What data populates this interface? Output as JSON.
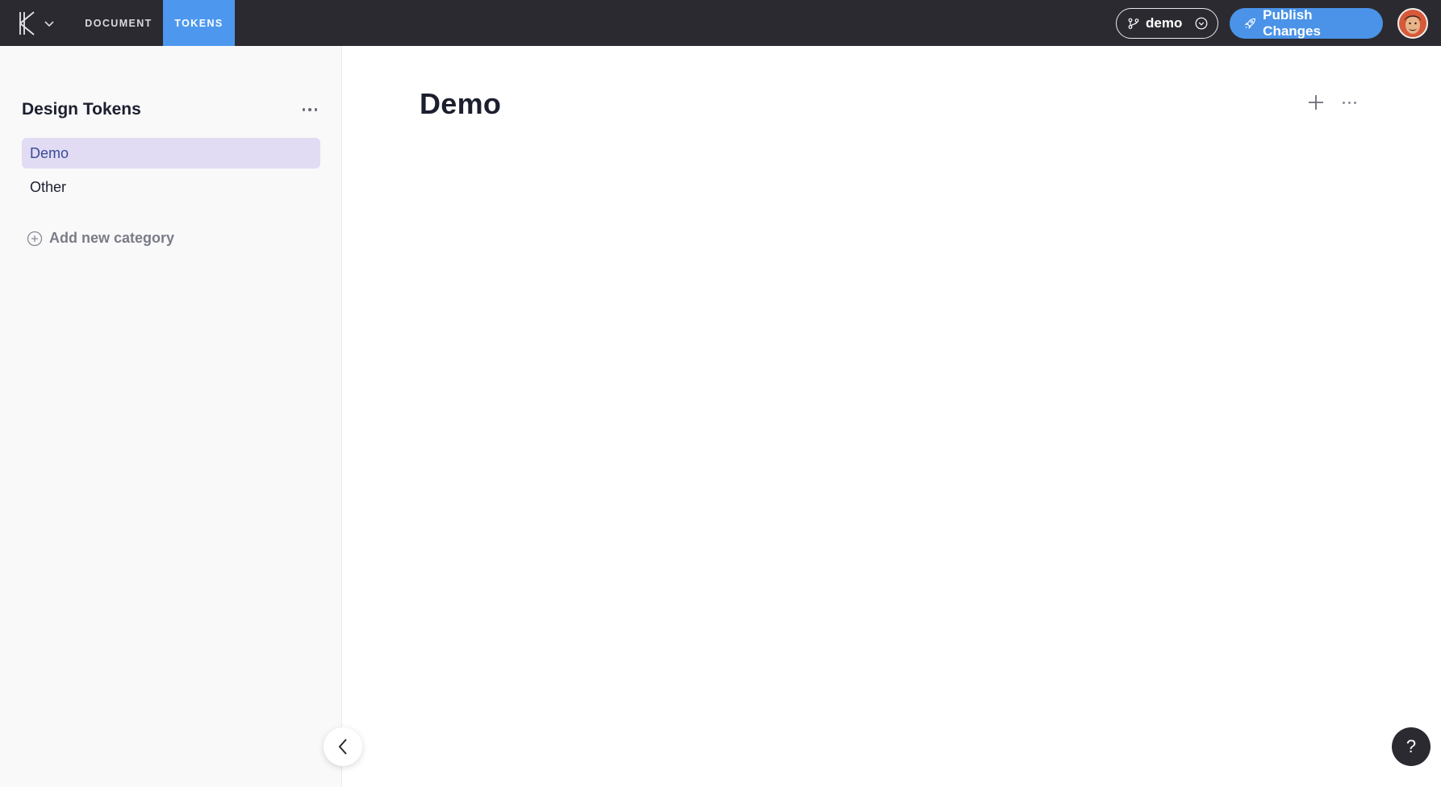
{
  "topbar": {
    "tabs": [
      {
        "label": "DOCUMENT",
        "active": false
      },
      {
        "label": "TOKENS",
        "active": true
      }
    ],
    "branch_label": "demo",
    "publish_label": "Publish Changes"
  },
  "sidebar": {
    "title": "Design Tokens",
    "items": [
      {
        "label": "Demo",
        "active": true
      },
      {
        "label": "Other",
        "active": false
      }
    ],
    "add_category_label": "Add new category"
  },
  "main": {
    "title": "Demo"
  },
  "help": {
    "label": "?"
  },
  "colors": {
    "topbar_bg": "#2b2a30",
    "accent_blue": "#4a93e8",
    "active_item_bg": "#e1dcf3",
    "active_item_text": "#3a4a9a"
  }
}
